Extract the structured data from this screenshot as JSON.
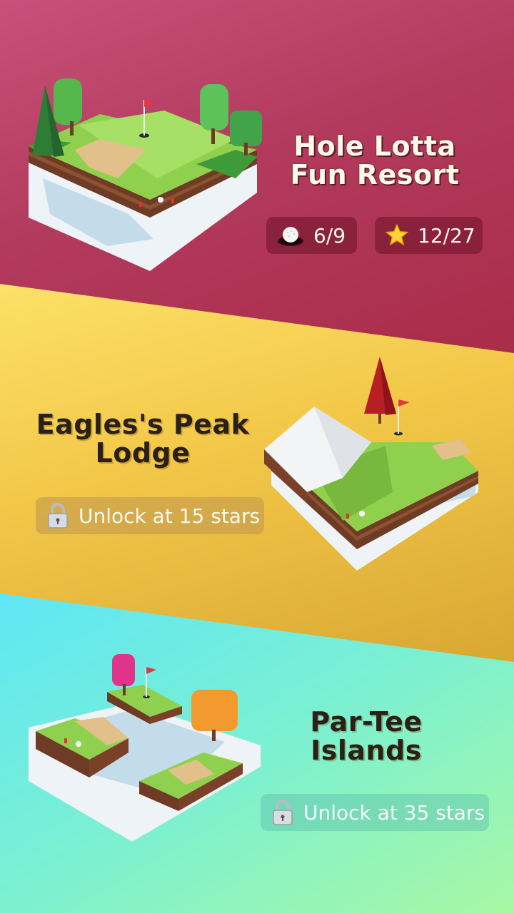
{
  "courses": [
    {
      "name_line1": "Hole Lotta",
      "name_line2": "Fun Resort",
      "holes_icon": "golf-ball-in-cup-icon",
      "holes": "6/9",
      "stars_icon": "star-icon",
      "stars": "12/27",
      "color": "#b23a5d"
    },
    {
      "name_line1": "Eagles's Peak",
      "name_line2": "Lodge",
      "lock_icon": "padlock-icon",
      "unlock_text": "Unlock at 15 stars",
      "color": "#f2c748"
    },
    {
      "name_line1": "Par-Tee",
      "name_line2": "Islands",
      "lock_icon": "padlock-icon",
      "unlock_text": "Unlock at 35 stars",
      "color": "#7bf0d2"
    }
  ]
}
